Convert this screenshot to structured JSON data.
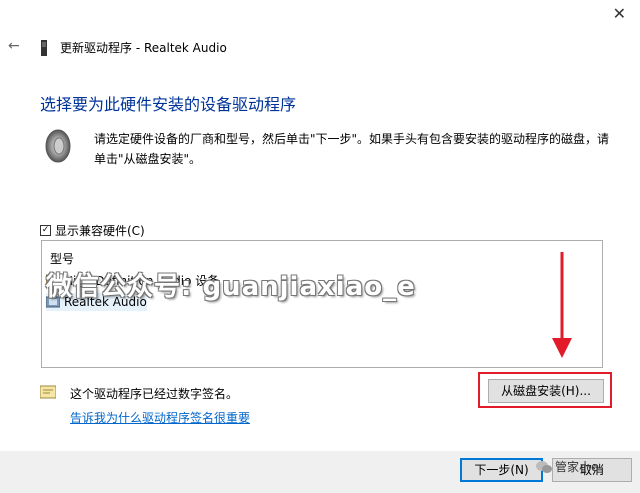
{
  "window": {
    "close_glyph": "✕",
    "back_glyph": "←",
    "wizard_title": "更新驱动程序 - Realtek Audio"
  },
  "page": {
    "heading": "选择要为此硬件安装的设备驱动程序",
    "description": "请选定硬件设备的厂商和型号，然后单击\"下一步\"。如果手头有包含要安装的驱动程序的磁盘，请单击\"从磁盘安装\"。",
    "show_compatible_label": "显示兼容硬件(C)",
    "show_compatible_checked": true
  },
  "model_list": {
    "header": "型号",
    "items": [
      {
        "label": "High Definition Audio 设备",
        "icon": "audio-device-icon",
        "selected": false
      },
      {
        "label": "Realtek Audio",
        "icon": "audio-device-icon",
        "selected": true
      }
    ]
  },
  "signature": {
    "status_text": "这个驱动程序已经过数字签名。",
    "link_text": "告诉我为什么驱动程序签名很重要",
    "icon": "signed-driver-icon"
  },
  "buttons": {
    "have_disk": "从磁盘安装(H)...",
    "next": "下一步(N)",
    "cancel": "取消"
  },
  "overlay": {
    "watermark_text": "微信公众号: guanjiaxiao_e",
    "wechat_badge": "管家小e",
    "highlight_color": "#e21b2a"
  },
  "colors": {
    "heading": "#003399",
    "link": "#0066cc",
    "accent": "#0078d7"
  }
}
